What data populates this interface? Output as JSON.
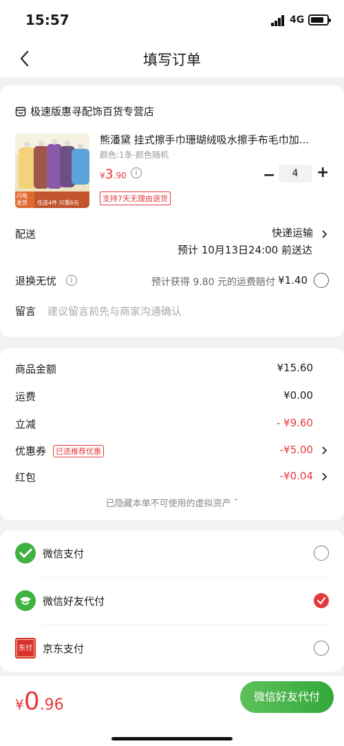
{
  "status": {
    "time": "15:57",
    "network": "4G"
  },
  "nav": {
    "title": "填写订单"
  },
  "store": {
    "name": "极速版惠寻配饰百货专营店"
  },
  "product": {
    "title": "熊潘黛 挂式擦手巾珊瑚绒吸水擦手布毛巾加...",
    "spec": "颜色:1条-颜色随机",
    "price_symbol": "¥",
    "price_int": "3",
    "price_dec": ".90",
    "quantity": "4",
    "return_badge": "支持7天无理由退货",
    "image_tag1": "闪电\n发货",
    "image_tag2": "任选4件 只需6元"
  },
  "delivery": {
    "label": "配送",
    "method": "快递运输",
    "estimate": "预计 10月13日24:00 前送达"
  },
  "return_worry": {
    "label": "退换无忧",
    "compensation_text": "预计获得 9.80 元的运费赔付",
    "price": "¥1.40"
  },
  "message": {
    "label": "留言",
    "placeholder": "建议留言前先与商家沟通确认"
  },
  "summary": {
    "goods_label": "商品金额",
    "goods_value": "¥15.60",
    "shipping_label": "运费",
    "shipping_value": "¥0.00",
    "discount_label": "立减",
    "discount_value": "- ¥9.60",
    "coupon_label": "优惠券",
    "coupon_tag": "已选推荐优惠",
    "coupon_value": "-¥5.00",
    "redpacket_label": "红包",
    "redpacket_value": "-¥0.04",
    "hidden_note": "已隐藏本单不可使用的虚拟资产 ˇ"
  },
  "payment": {
    "options": [
      {
        "label": "微信支付",
        "selected": false
      },
      {
        "label": "微信好友代付",
        "selected": true
      },
      {
        "label": "京东支付",
        "selected": false
      }
    ],
    "jd_icon_text": "东付"
  },
  "footer": {
    "total_symbol": "¥",
    "total_int": "0",
    "total_dec": ".96",
    "pay_button": "微信好友代付"
  },
  "colors": {
    "accent_red": "#e4393c",
    "wechat_green": "#3fb23f"
  }
}
